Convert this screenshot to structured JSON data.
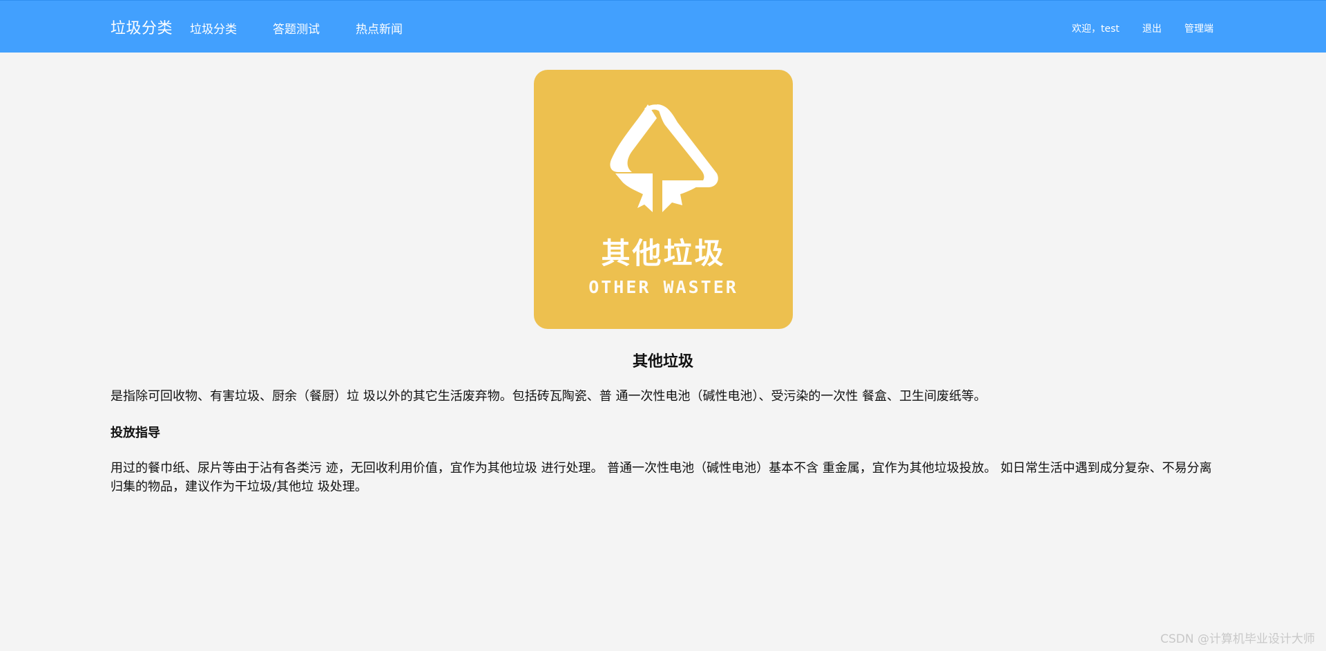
{
  "nav": {
    "brand": "垃圾分类",
    "links": [
      "垃圾分类",
      "答题测试",
      "热点新闻"
    ],
    "welcome": "欢迎，test",
    "logout": "退出",
    "admin": "管理端"
  },
  "card": {
    "image_title_cn": "其他垃圾",
    "image_title_en": "OTHER WASTER",
    "image_icon": "recycle-arrows-icon",
    "title": "其他垃圾",
    "description": "是指除可回收物、有害垃圾、厨余（餐厨）垃 圾以外的其它生活废弃物。包括砖瓦陶瓷、普 通一次性电池（碱性电池）、受污染的一次性 餐盒、卫生间废纸等。",
    "guide_heading": "投放指导",
    "guide_text": "用过的餐巾纸、尿片等由于沾有各类污 迹，无回收利用价值，宜作为其他垃圾 进行处理。 普通一次性电池（碱性电池）基本不含 重金属，宜作为其他垃圾投放。 如日常生活中遇到成分复杂、不易分离 归集的物品，建议作为干垃圾/其他垃 圾处理。"
  },
  "watermark": "CSDN @计算机毕业设计大师",
  "colors": {
    "navbar": "#42a0fe",
    "background": "#f4f4f4",
    "badge": "#edc04f"
  }
}
